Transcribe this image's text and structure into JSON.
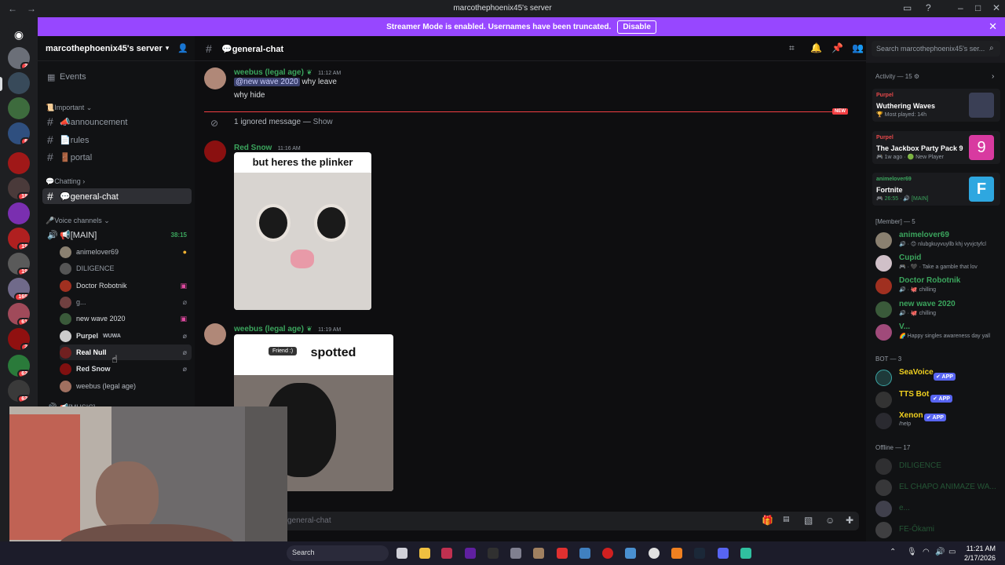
{
  "window": {
    "title": "marcothephoenix45's server"
  },
  "banner": {
    "text": "Streamer Mode is enabled. Usernames have been truncated.",
    "button": "Disable"
  },
  "server": {
    "name": "marcothephoenix45's server"
  },
  "server_badges": [
    "2",
    "6",
    "18",
    "19",
    "19",
    "165",
    "61",
    "2",
    "62",
    "62"
  ],
  "channels": {
    "events": "Events",
    "cat_important": "📜Important",
    "announcement": "📣announcement",
    "rules": "📄rules",
    "portal": "🚪portal",
    "cat_chatting": "💬Chatting",
    "general": "💬general-chat",
    "cat_voice": "🎤Voice channels",
    "main_voice": "📢[MAIN]",
    "main_timer": "38:15",
    "music": "📢[MUSIC]"
  },
  "voice_users": [
    {
      "name": "animelover69",
      "color": "#b5bac1"
    },
    {
      "name": "DILIGENCE",
      "color": "#949ba4"
    },
    {
      "name": "Doctor Robotnik",
      "color": "#dbdee1"
    },
    {
      "name": "g...",
      "color": "#949ba4"
    },
    {
      "name": "new wave 2020",
      "color": "#dbdee1"
    },
    {
      "name": "Purpel",
      "color": "#dbdee1"
    },
    {
      "name": "Real Null",
      "color": "#ffffff"
    },
    {
      "name": "Red Snow",
      "color": "#dbdee1"
    },
    {
      "name": "weebus (legal age)",
      "color": "#b5bac1"
    }
  ],
  "purpel_tag": "WUWA",
  "chat": {
    "channel_title": "💬general-chat",
    "search_placeholder": "Search marcothephoenix45's ser...",
    "msg1": {
      "user": "weebus (legal age)",
      "time": "11:12 AM",
      "mention": "@new wave 2020",
      "text1": "why leave",
      "text2": "why hide"
    },
    "new_label": "NEW",
    "ignored": "1 ignored message —",
    "show": "Show",
    "msg2": {
      "user": "Red Snow",
      "time": "11:16 AM",
      "caption": "but heres the plinker"
    },
    "msg3": {
      "user": "weebus (legal age)",
      "time": "11:19 AM",
      "caption": "spotted",
      "tooltip": "Friend :)"
    },
    "input_placeholder": "general-chat"
  },
  "members": {
    "activity_header": "Activity — 15",
    "activities": [
      {
        "user": "Purpel",
        "game": "Wuthering Waves",
        "detail": "🏆 Most played: 14h",
        "color": "#e7484a",
        "thumb": "#3a3f55"
      },
      {
        "user": "Purpel",
        "game": "The Jackbox Party Pack 9",
        "detail": "🎮 1w ago · 🟢 New Player",
        "color": "#e7484a",
        "thumb": "#d83aa0"
      },
      {
        "user": "animelover69",
        "game": "Fortnite",
        "detail": "🎮 26:55 · 🔊 [MAIN]",
        "color": "#3ba55d",
        "thumb": "#2ea7e0"
      }
    ],
    "member_header": "[Member] — 5",
    "member_list": [
      {
        "name": "animelover69",
        "status": "🔊 · 😊 nlubgkuyvuyllb khj vyvjctyfcl",
        "color": "#3ba55d"
      },
      {
        "name": "Cupid",
        "status": "🎮 · 🖤 · Take a gamble that lov",
        "color": "#3ba55d"
      },
      {
        "name": "Doctor Robotnik",
        "status": "🔊 · 🐙 chilling",
        "color": "#3ba55d"
      },
      {
        "name": "new wave 2020",
        "status": "🔊 · 🐙 chilling",
        "color": "#3ba55d"
      },
      {
        "name": "V...",
        "status": "🌈 Happy singles awareness day yall",
        "color": "#3ba55d"
      }
    ],
    "bot_header": "BOT — 3",
    "bots": [
      {
        "name": "SeaVoice",
        "tag": "✔ APP",
        "status": ""
      },
      {
        "name": "TTS Bot",
        "tag": "✔ APP",
        "status": ""
      },
      {
        "name": "Xenon",
        "tag": "✔ APP",
        "status": "/help"
      }
    ],
    "offline_header": "Offline — 17",
    "offline": [
      "DILIGENCE",
      "EL CHAPO ANIMAZE WA...",
      "e...",
      "FE-Ōkami"
    ]
  },
  "taskbar": {
    "search": "Search",
    "time": "11:21 AM",
    "date": "2/17/2026"
  }
}
